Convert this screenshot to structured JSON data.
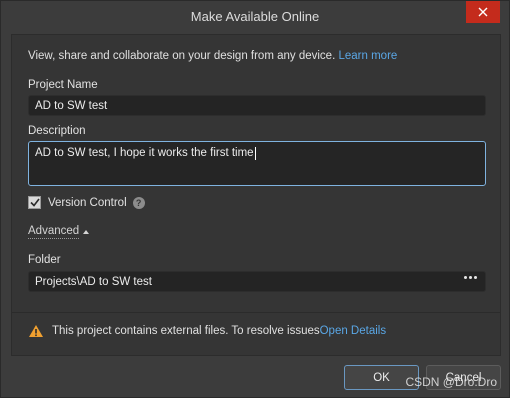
{
  "window": {
    "title": "Make Available Online",
    "close_icon": "close-icon"
  },
  "intro": {
    "text": "View, share and collaborate on your design from any device. ",
    "link": "Learn more"
  },
  "project_name": {
    "label": "Project Name",
    "value": "AD to SW test"
  },
  "description": {
    "label": "Description",
    "value": "AD to SW test, I hope it works the first time"
  },
  "version_control": {
    "label": "Version Control",
    "checked": true,
    "help_icon": "?"
  },
  "advanced": {
    "label": "Advanced"
  },
  "folder": {
    "label": "Folder",
    "value": "Projects\\AD to SW test"
  },
  "warning": {
    "text": "This project contains external files. To resolve issues ",
    "link": "Open Details"
  },
  "buttons": {
    "ok": "OK",
    "cancel": "Cancel"
  },
  "watermark": "CSDN @Dro.Dro",
  "colors": {
    "accent_link": "#5aa7e6",
    "close_button": "#c42b1c",
    "warning": "#f0a030"
  }
}
